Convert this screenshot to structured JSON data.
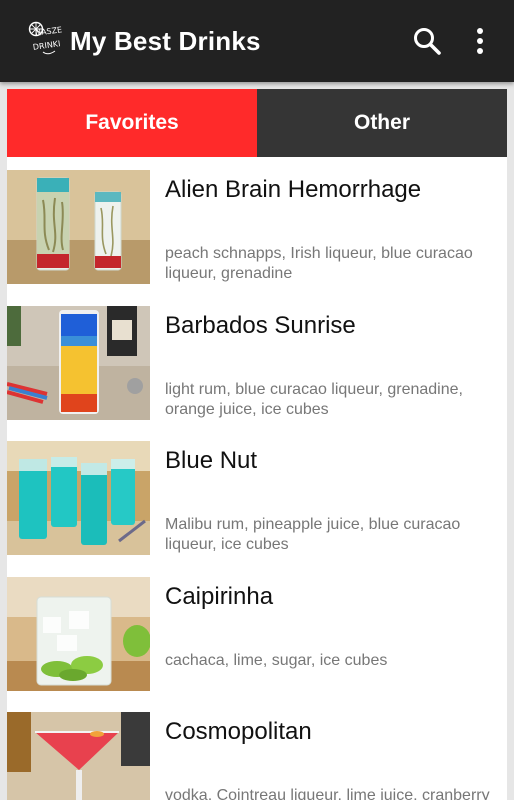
{
  "app": {
    "title": "My Best Drinks",
    "logo_text": "NASZE DRINKI"
  },
  "toolbar": {
    "search_icon": "search-icon",
    "overflow_icon": "more-vert-icon"
  },
  "tabs": [
    {
      "label": "Favorites",
      "selected": true,
      "color": "#ff2a2a"
    },
    {
      "label": "Other",
      "selected": false,
      "color": "#353535"
    }
  ],
  "drinks": [
    {
      "name": "Alien Brain Hemorrhage",
      "ingredients": "peach schnapps, Irish liqueur, blue curacao liqueur, grenadine"
    },
    {
      "name": "Barbados Sunrise",
      "ingredients": "light rum, blue curacao liqueur, grenadine, orange juice, ice cubes"
    },
    {
      "name": "Blue Nut",
      "ingredients": "Malibu rum, pineapple juice, blue curacao liqueur, ice cubes"
    },
    {
      "name": "Caipirinha",
      "ingredients": "cachaca, lime, sugar, ice cubes"
    },
    {
      "name": "Cosmopolitan",
      "ingredients": "vodka, Cointreau liqueur, lime juice, cranberry"
    }
  ],
  "colors": {
    "actionbar": "#222222",
    "accent": "#ff2a2a",
    "tab_inactive": "#353535"
  }
}
